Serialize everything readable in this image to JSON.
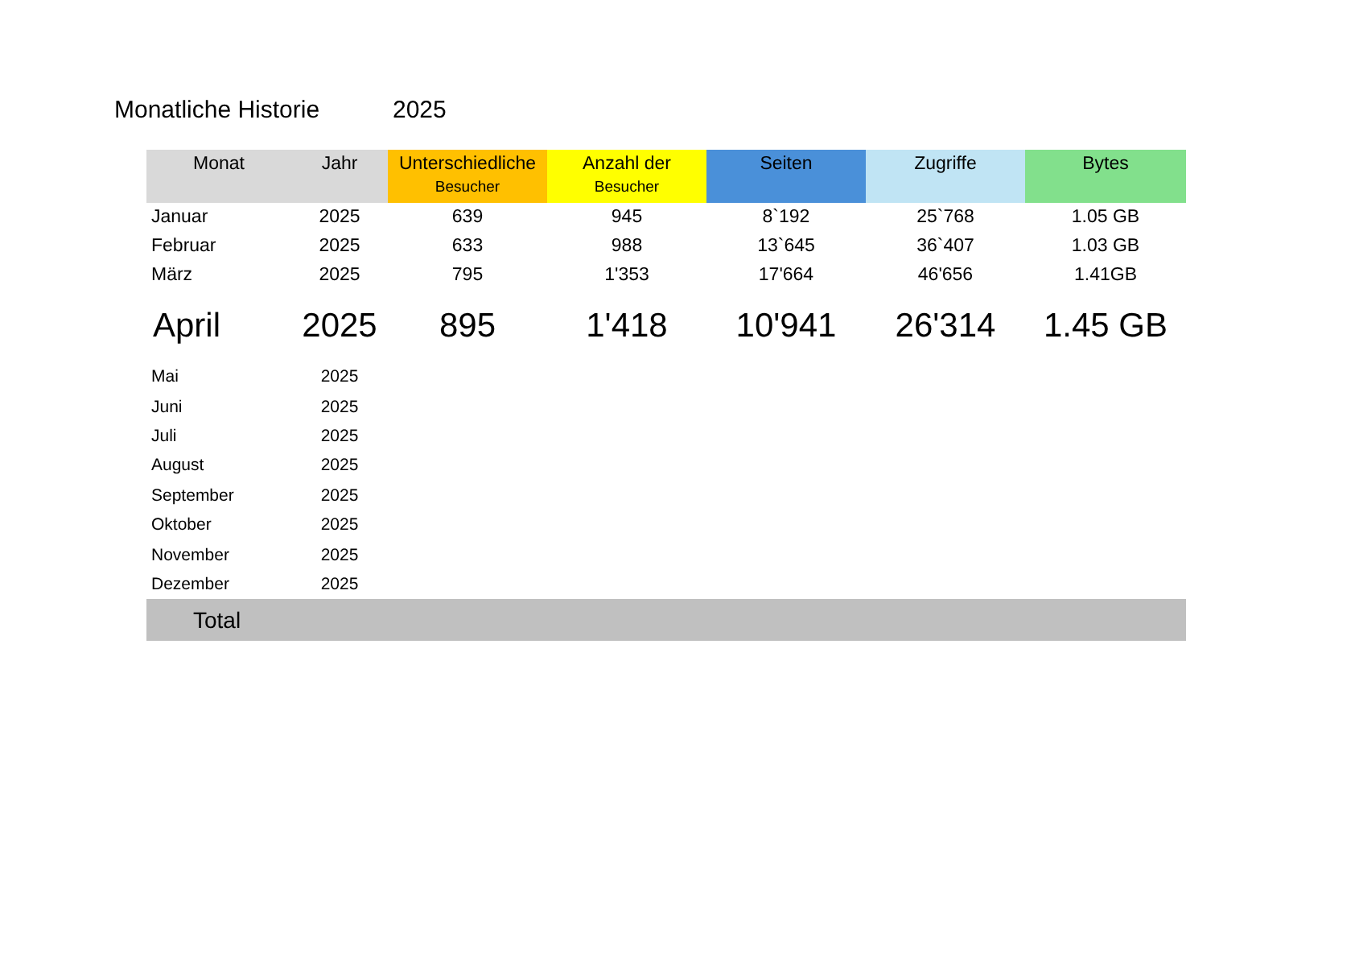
{
  "title": "Monatliche Historie",
  "year": "2025",
  "columns": [
    {
      "label": "Monat",
      "color": "#d9d9d9"
    },
    {
      "label": "Jahr",
      "color": "#d9d9d9"
    },
    {
      "label": "Unterschiedliche",
      "sublabel": "Besucher",
      "color": "#ffc000"
    },
    {
      "label": "Anzahl der",
      "sublabel": "Besucher",
      "color": "#ffff00"
    },
    {
      "label": "Seiten",
      "color": "#4a90d9"
    },
    {
      "label": "Zugriffe",
      "color": "#c0e4f4"
    },
    {
      "label": "Bytes",
      "color": "#82e08c"
    }
  ],
  "rows": [
    {
      "kind": "normal",
      "cells": [
        "Januar",
        "2025",
        "639",
        "945",
        "8`192",
        "25`768",
        "1.05 GB"
      ]
    },
    {
      "kind": "normal",
      "cells": [
        "Februar",
        "2025",
        "633",
        "988",
        "13`645",
        "36`407",
        "1.03 GB"
      ]
    },
    {
      "kind": "normal",
      "cells": [
        "März",
        "2025",
        "795",
        "1'353",
        "17'664",
        "46'656",
        "1.41GB"
      ]
    },
    {
      "kind": "large",
      "cells": [
        "April",
        "2025",
        "895",
        "1'418",
        "10'941",
        "26'314",
        "1.45 GB"
      ]
    },
    {
      "kind": "small",
      "cells": [
        "Mai",
        "2025"
      ]
    },
    {
      "kind": "small",
      "cells": [
        "Juni",
        "2025"
      ]
    },
    {
      "kind": "small",
      "cells": [
        "Juli",
        "2025"
      ]
    },
    {
      "kind": "small",
      "cells": [
        "August",
        "2025"
      ]
    },
    {
      "kind": "small",
      "cells": [
        "September",
        "2025"
      ]
    },
    {
      "kind": "small",
      "cells": [
        "Oktober",
        "2025"
      ]
    },
    {
      "kind": "small",
      "cells": [
        "November",
        "2025"
      ]
    },
    {
      "kind": "small",
      "cells": [
        "Dezember",
        "2025"
      ]
    }
  ],
  "total": {
    "label": "Total"
  }
}
